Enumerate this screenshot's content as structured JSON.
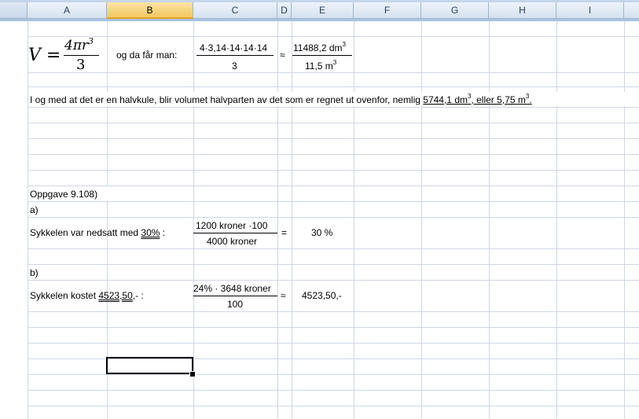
{
  "columns": [
    "A",
    "B",
    "C",
    "D",
    "E",
    "F",
    "G",
    "H",
    "I"
  ],
  "selected_column": "B",
  "formula": {
    "lhs": "V =",
    "numerator": "4πr",
    "numerator_exp": "3",
    "denominator": "3"
  },
  "row_formula": {
    "label": "og da får man:",
    "c_numerator": "4·3,14·14·14·14",
    "c_denominator": "3",
    "approx": "≈",
    "e_numerator": "11488,2 dm",
    "e_numerator_exp": "3",
    "e_denominator": "11,5 m",
    "e_denominator_exp": "3"
  },
  "sentence": {
    "text": "I og med at det er en halvkule, blir volumet halvparten av det som er regnet ut ovenfor, nemlig ",
    "answer1": "5744,1 dm",
    "answer1_exp": "3",
    "connector": ", eller 5,75 m",
    "answer2_exp": "3",
    "end": "."
  },
  "task": {
    "heading": "Oppgave 9.108)",
    "a_label": "a)",
    "a_text": "Sykkelen var nedsatt med ",
    "a_answer": "30%",
    "a_colon": " :",
    "a_numerator": "1200 kroner ·100",
    "a_denominator": "4000 kroner",
    "a_equals": "=",
    "a_result": "30 %",
    "b_label": "b)",
    "b_text": "Sykkelen kostet ",
    "b_answer": "4523,50",
    "b_suffix": ",- :",
    "b_numerator": "24% · 3648 kroner",
    "b_denominator": "100",
    "b_approx": "≈",
    "b_result": "4523,50,-"
  }
}
